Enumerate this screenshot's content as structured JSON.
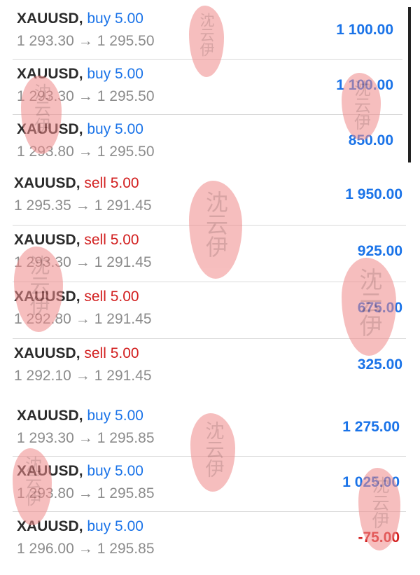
{
  "sections": [
    {
      "rows": [
        {
          "symbol": "XAUUSD",
          "type": "buy 5.00",
          "direction": "buy",
          "open": "1 293.30",
          "close": "1 295.50",
          "profit": "1 100.00"
        },
        {
          "symbol": "XAUUSD",
          "type": "buy 5.00",
          "direction": "buy",
          "open": "1 293.30",
          "close": "1 295.50",
          "profit": "1 100.00"
        },
        {
          "symbol": "XAUUSD",
          "type": "buy 5.00",
          "direction": "buy",
          "open": "1 293.80",
          "close": "1 295.50",
          "profit": "850.00"
        }
      ]
    },
    {
      "rows": [
        {
          "symbol": "XAUUSD",
          "type": "sell 5.00",
          "direction": "sell",
          "open": "1 295.35",
          "close": "1 291.45",
          "profit": "1 950.00"
        },
        {
          "symbol": "XAUUSD",
          "type": "sell 5.00",
          "direction": "sell",
          "open": "1 293.30",
          "close": "1 291.45",
          "profit": "925.00"
        },
        {
          "symbol": "XAUUSD",
          "type": "sell 5.00",
          "direction": "sell",
          "open": "1 292.80",
          "close": "1 291.45",
          "profit": "675.00"
        },
        {
          "symbol": "XAUUSD",
          "type": "sell 5.00",
          "direction": "sell",
          "open": "1 292.10",
          "close": "1 291.45",
          "profit": "325.00"
        }
      ]
    },
    {
      "rows": [
        {
          "symbol": "XAUUSD",
          "type": "buy 5.00",
          "direction": "buy",
          "open": "1 293.30",
          "close": "1 295.85",
          "profit": "1 275.00"
        },
        {
          "symbol": "XAUUSD",
          "type": "buy 5.00",
          "direction": "buy",
          "open": "1 293.80",
          "close": "1 295.85",
          "profit": "1 025.00"
        },
        {
          "symbol": "XAUUSD",
          "type": "buy 5.00",
          "direction": "buy",
          "open": "1 296.00",
          "close": "1 295.85",
          "profit": "-75.00"
        }
      ]
    }
  ],
  "arrow": "→",
  "colors": {
    "buy": "#1a73e8",
    "sell": "#d21f1f",
    "positive_profit": "#1a73e8",
    "negative_profit": "#d21f1f",
    "price_text": "#8c8c8c",
    "symbol_text": "#2b2b2b",
    "watermark": "#f08a8a"
  },
  "watermark_text": "沈云伊"
}
